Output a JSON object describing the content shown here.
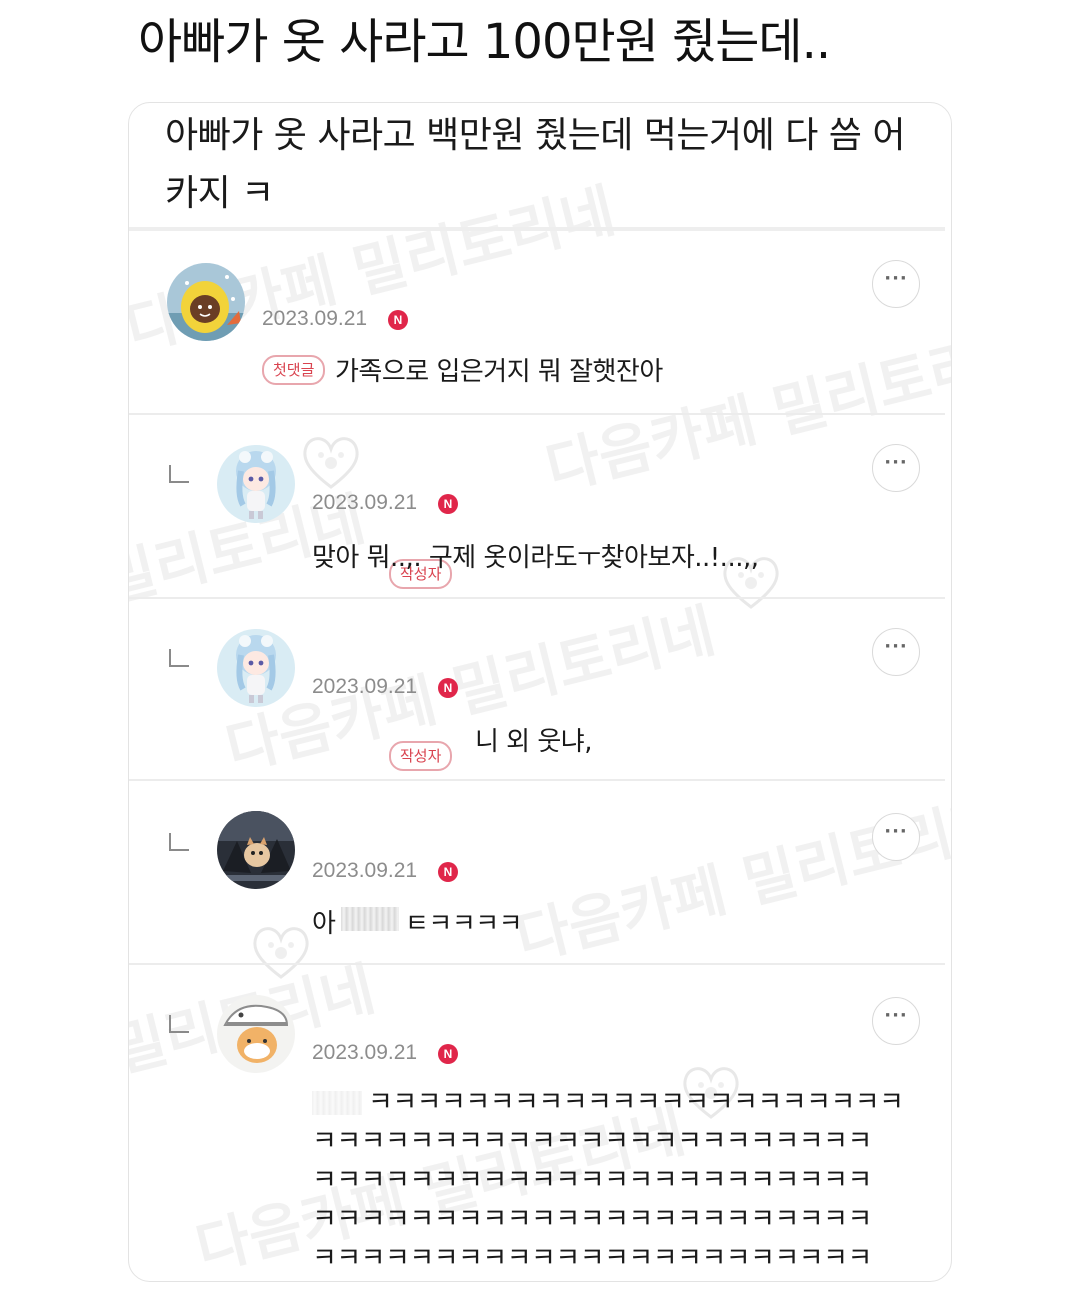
{
  "page": {
    "title": "아빠가 옷 사라고 100만원 줬는데.."
  },
  "post": {
    "text": "아빠가 옷 사라고 백만원 줬는데 먹는거에 다 씀 어카지 ㅋ"
  },
  "watermarks": {
    "cafe": "다음카페",
    "board": "밀리토리네",
    "combined": "다음카페 밀리토리네"
  },
  "colors": {
    "badge_red": "#e0264a",
    "tag_border": "#e8a6ad",
    "tag_text": "#d9434f",
    "date_gray": "#8c8c8c"
  },
  "comments": [
    {
      "avatar": "yellow-raincoat-character-avatar",
      "date": "2023.09.21",
      "badge": "N",
      "tag": "첫댓글",
      "text": "가족으로 입은거지 뭐 잘햇잔아",
      "is_reply": false,
      "more": "···"
    },
    {
      "avatar": "blue-hair-doll-avatar",
      "date": "2023.09.21",
      "badge": "N",
      "tag": "작성자",
      "text": "맞아 뭐..,. 구제 옷이라도ㅜ찾아보자..!...,,",
      "is_reply": true,
      "more": "···"
    },
    {
      "avatar": "blue-hair-doll-avatar",
      "date": "2023.09.21",
      "badge": "N",
      "tag": "작성자",
      "text": "니 외 웃냐,",
      "is_reply": true,
      "more": "···"
    },
    {
      "avatar": "dark-photo-dog-avatar",
      "date": "2023.09.21",
      "badge": "N",
      "text_prefix": "아",
      "text_suffix": "ㅌㅋㅋㅋㅋ",
      "is_reply": true,
      "more": "···"
    },
    {
      "avatar": "dinosaur-hat-character-avatar",
      "date": "2023.09.21",
      "badge": "N",
      "text": "ㅋㅋㅋㅋㅋㅋㅋㅋㅋㅋㅋㅋㅋㅋㅋㅋㅋㅋㅋㅋㅋㅋ\nㅋㅋㅋㅋㅋㅋㅋㅋㅋㅋㅋㅋㅋㅋㅋㅋㅋㅋㅋㅋㅋㅋㅋ\nㅋㅋㅋㅋㅋㅋㅋㅋㅋㅋㅋㅋㅋㅋㅋㅋㅋㅋㅋㅋㅋㅋㅋ\nㅋㅋㅋㅋㅋㅋㅋㅋㅋㅋㅋㅋㅋㅋㅋㅋㅋㅋㅋㅋㅋㅋㅋ\nㅋㅋㅋㅋㅋㅋㅋㅋㅋㅋㅋㅋㅋㅋㅋㅋㅋㅋㅋㅋㅋㅋㅋ",
      "is_reply": true,
      "more": "···"
    }
  ]
}
